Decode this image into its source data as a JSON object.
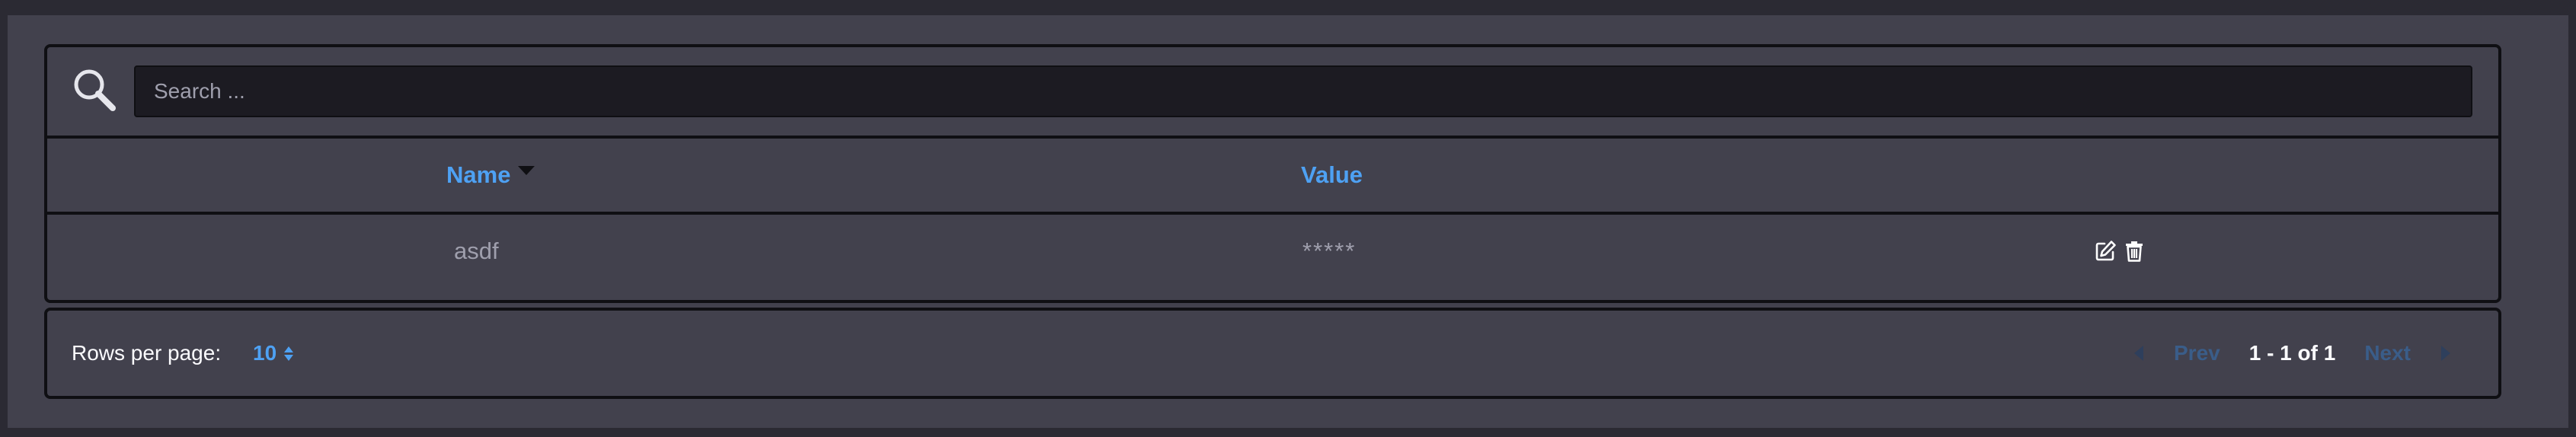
{
  "search": {
    "placeholder": "Search ..."
  },
  "table": {
    "columns": [
      {
        "label": "Name",
        "sorted": "descending"
      },
      {
        "label": "Value"
      }
    ],
    "rows": [
      {
        "name": "asdf",
        "value": "*****"
      }
    ]
  },
  "pagination": {
    "rows_per_page_label": "Rows per page:",
    "rows_per_page_value": "10",
    "prev_label": "Prev",
    "next_label": "Next",
    "page_info": "1 - 1 of 1"
  },
  "icons": {
    "search": "search-icon",
    "sort": "caret-down-icon",
    "edit": "edit-icon",
    "delete": "trash-icon"
  },
  "colors": {
    "background": "#2b2a33",
    "panel": "#42414d",
    "accent": "#4ea1f3",
    "border": "#0f0f13",
    "muted_text": "#9f9fad",
    "disabled_link": "#3a5d89"
  }
}
